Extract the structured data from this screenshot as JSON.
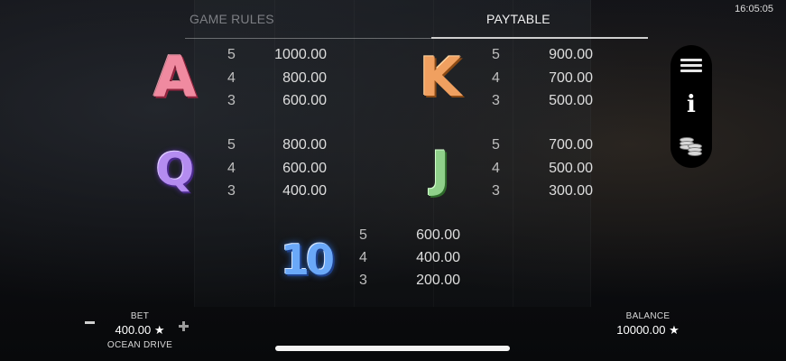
{
  "status": {
    "time": "16:05:05"
  },
  "tabs": [
    {
      "label": "GAME RULES",
      "active": false
    },
    {
      "label": "PAYTABLE",
      "active": true
    }
  ],
  "paytable": [
    {
      "symbol": "A",
      "color": "#f08aa0",
      "rows": [
        {
          "count": "5",
          "value": "1000.00"
        },
        {
          "count": "4",
          "value": "800.00"
        },
        {
          "count": "3",
          "value": "600.00"
        }
      ]
    },
    {
      "symbol": "K",
      "color": "#f0a060",
      "rows": [
        {
          "count": "5",
          "value": "900.00"
        },
        {
          "count": "4",
          "value": "700.00"
        },
        {
          "count": "3",
          "value": "500.00"
        }
      ]
    },
    {
      "symbol": "Q",
      "color": "#b48cf0",
      "rows": [
        {
          "count": "5",
          "value": "800.00"
        },
        {
          "count": "4",
          "value": "600.00"
        },
        {
          "count": "3",
          "value": "400.00"
        }
      ]
    },
    {
      "symbol": "J",
      "color": "#8fd08a",
      "rows": [
        {
          "count": "5",
          "value": "700.00"
        },
        {
          "count": "4",
          "value": "500.00"
        },
        {
          "count": "3",
          "value": "300.00"
        }
      ]
    },
    {
      "symbol": "10",
      "color": "#6aa8f8",
      "rows": [
        {
          "count": "5",
          "value": "600.00"
        },
        {
          "count": "4",
          "value": "400.00"
        },
        {
          "count": "3",
          "value": "200.00"
        }
      ]
    }
  ],
  "side_menu": {
    "icons": [
      "menu-icon",
      "info-icon",
      "coins-icon"
    ]
  },
  "bet": {
    "label": "BET",
    "amount": "400.00 ★",
    "game_name": "OCEAN DRIVE"
  },
  "balance": {
    "label": "BALANCE",
    "amount": "10000.00 ★"
  }
}
